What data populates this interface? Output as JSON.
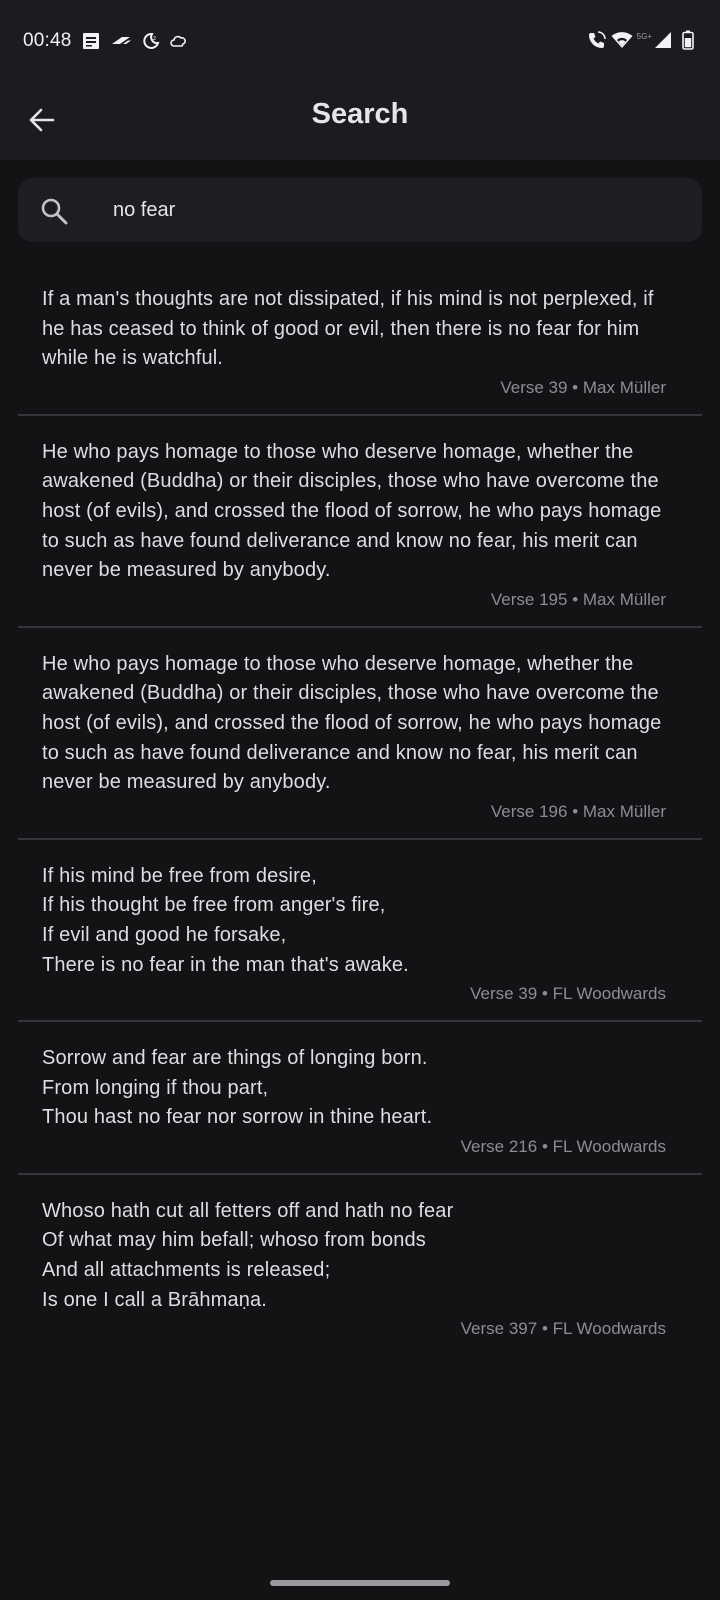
{
  "status_bar": {
    "time": "00:48",
    "network_label": "5G+"
  },
  "header": {
    "title": "Search"
  },
  "search": {
    "value": "no fear",
    "placeholder": "Search"
  },
  "results": [
    {
      "text": "If a man's thoughts are not dissipated, if his mind is not perplexed, if he has ceased to think of good or evil, then there is no fear for him while he is watchful.",
      "meta": "Verse 39 • Max Müller"
    },
    {
      "text": "He who pays homage to those who deserve homage, whether the awakened (Buddha) or their disciples, those who have overcome the host (of evils), and crossed the flood of sorrow, he who pays homage to such as have found deliverance and know no fear, his merit can never be measured by anybody.",
      "meta": "Verse 195 • Max Müller"
    },
    {
      "text": "He who pays homage to those who deserve homage, whether the awakened (Buddha) or their disciples, those who have overcome the host (of evils), and crossed the flood of sorrow, he who pays homage to such as have found deliverance and know no fear, his merit can never be measured by anybody.",
      "meta": "Verse 196 • Max Müller"
    },
    {
      "text": "If his mind be free from desire,\nIf his thought be free from anger's fire,\nIf evil and good he forsake,\nThere is no fear in the man that's awake.",
      "meta": "Verse 39 • FL Woodwards"
    },
    {
      "text": "Sorrow and fear are things of longing born.\nFrom longing if thou part,\nThou hast no fear nor sorrow in thine heart.",
      "meta": "Verse 216 • FL Woodwards"
    },
    {
      "text": "Whoso hath cut all fetters off and hath no fear\nOf what may him befall; whoso from bonds\nAnd all attachments is released;\nIs one I call a Brāhmaṇa.",
      "meta": "Verse 397 • FL Woodwards"
    }
  ],
  "colors": {
    "background": "#131315",
    "appbar": "#1b1c20",
    "search_box": "#1d1e22",
    "divider": "#35363a",
    "meta_text": "#8c8d92"
  }
}
